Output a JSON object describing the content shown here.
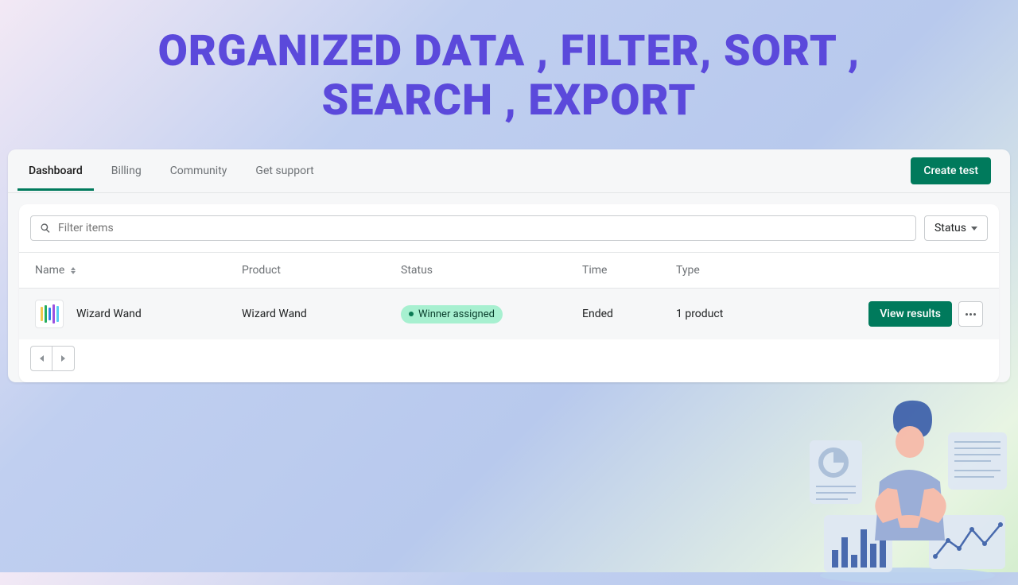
{
  "hero": {
    "line1": "ORGANIZED DATA , FILTER, SORT ,",
    "line2": "SEARCH , EXPORT"
  },
  "tabs": [
    {
      "label": "Dashboard",
      "active": true
    },
    {
      "label": "Billing",
      "active": false
    },
    {
      "label": "Community",
      "active": false
    },
    {
      "label": "Get support",
      "active": false
    }
  ],
  "create_label": "Create test",
  "search": {
    "placeholder": "Filter items"
  },
  "status_dropdown": {
    "label": "Status"
  },
  "columns": {
    "name": "Name",
    "product": "Product",
    "status": "Status",
    "time": "Time",
    "type": "Type"
  },
  "rows": [
    {
      "name": "Wizard Wand",
      "product": "Wizard Wand",
      "status_badge": "Winner assigned",
      "time": "Ended",
      "type": "1 product",
      "action_label": "View results"
    }
  ],
  "colors": {
    "accent": "#007a5c",
    "badge_bg": "#a7f0d0",
    "title": "#5b49db"
  }
}
